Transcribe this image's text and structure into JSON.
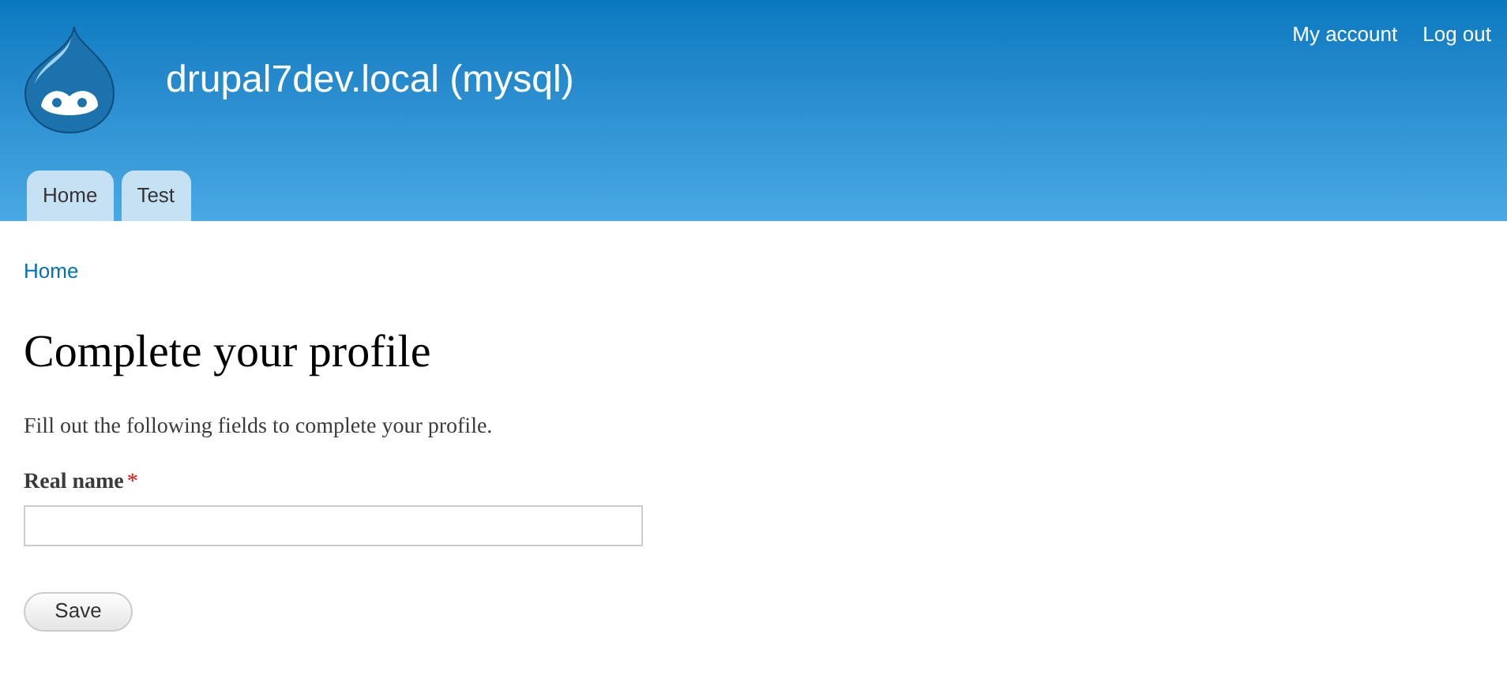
{
  "header": {
    "site_name": "drupal7dev.local (mysql)",
    "secondary_links": [
      "My account",
      "Log out"
    ],
    "tabs": [
      {
        "label": "Home"
      },
      {
        "label": "Test"
      }
    ]
  },
  "breadcrumb": [
    "Home"
  ],
  "page": {
    "title": "Complete your profile",
    "intro": "Fill out the following fields to complete your profile.",
    "field": {
      "label": "Real name",
      "required_mark": "*"
    },
    "button": "Save"
  }
}
